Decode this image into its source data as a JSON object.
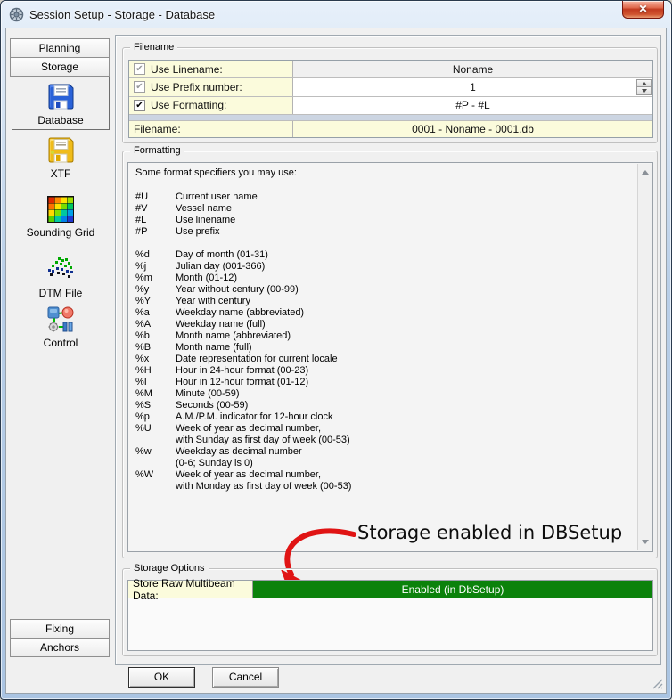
{
  "window": {
    "title": "Session Setup - Storage -  Database"
  },
  "icons": {
    "close": "✕",
    "check": "✔",
    "app_icon": "gear-icon",
    "spinner": "up-down-arrows",
    "scrollbar": "up-down-arrows"
  },
  "sidebar": {
    "top_buttons": [
      {
        "label": "Planning"
      },
      {
        "label": "Storage"
      }
    ],
    "nav_items": [
      {
        "label": "Database",
        "icon": "blue-floppy-disk",
        "selected": true
      },
      {
        "label": "XTF",
        "icon": "yellow-floppy-disk",
        "selected": false
      },
      {
        "label": "Sounding Grid",
        "icon": "rainbow-grid",
        "selected": false
      },
      {
        "label": "DTM File",
        "icon": "pixel-mesh",
        "selected": false
      },
      {
        "label": "Control",
        "icon": "control-composite",
        "selected": false
      }
    ],
    "bottom_buttons": [
      {
        "label": "Fixing"
      },
      {
        "label": "Anchors"
      }
    ]
  },
  "filename_group": {
    "legend": "Filename",
    "rows": [
      {
        "label": "Use Linename:",
        "value": "Noname",
        "checked": true,
        "enabled": false
      },
      {
        "label": "Use Prefix number:",
        "value": "1",
        "checked": true,
        "enabled": false
      },
      {
        "label": "Use Formatting:",
        "value": "#P - #L",
        "checked": true,
        "enabled": true
      }
    ],
    "filename_row": {
      "label": "Filename:",
      "value": "0001 - Noname - 0001.db"
    }
  },
  "formatting_group": {
    "legend": "Formatting",
    "intro": "Some format specifiers you may use:",
    "items": [
      {
        "spec": "#U",
        "desc": "Current user name"
      },
      {
        "spec": "#V",
        "desc": "Vessel name"
      },
      {
        "spec": "#L",
        "desc": "Use linename"
      },
      {
        "spec": "#P",
        "desc": "Use prefix"
      },
      {
        "spec": "%d",
        "desc": "Day of month (01-31)"
      },
      {
        "spec": "%j",
        "desc": "Julian day (001-366)"
      },
      {
        "spec": "%m",
        "desc": "Month (01-12)"
      },
      {
        "spec": "%y",
        "desc": "Year without century (00-99)"
      },
      {
        "spec": "%Y",
        "desc": "Year with century"
      },
      {
        "spec": "%a",
        "desc": "Weekday name (abbreviated)"
      },
      {
        "spec": "%A",
        "desc": "Weekday name (full)"
      },
      {
        "spec": "%b",
        "desc": "Month name (abbreviated)"
      },
      {
        "spec": "%B",
        "desc": "Month name (full)"
      },
      {
        "spec": "%x",
        "desc": "Date representation for current locale"
      },
      {
        "spec": "%H",
        "desc": "Hour in 24-hour format (00-23)"
      },
      {
        "spec": "%I",
        "desc": "Hour in 12-hour format (01-12)"
      },
      {
        "spec": "%M",
        "desc": "Minute (00-59)"
      },
      {
        "spec": "%S",
        "desc": "Seconds (00-59)"
      },
      {
        "spec": "%p",
        "desc": "A.M./P.M. indicator for 12-hour clock"
      },
      {
        "spec": "%U",
        "desc": "Week of year as decimal number,\nwith Sunday as first day of week (00-53)"
      },
      {
        "spec": "%w",
        "desc": "Weekday as decimal number\n(0-6; Sunday is 0)"
      },
      {
        "spec": "%W",
        "desc": "Week of year as decimal number,\nwith Monday as first day of week (00-53)"
      }
    ]
  },
  "annotation": {
    "text": "Storage enabled in DBSetup",
    "arrow_color": "#e01414"
  },
  "storage_group": {
    "legend": "Storage Options",
    "row": {
      "label": "Store Raw Multibeam Data:",
      "value": "Enabled (in DbSetup)",
      "status_color": "#0b820b"
    }
  },
  "footer": {
    "ok": "OK",
    "cancel": "Cancel"
  },
  "colors": {
    "row_highlight_yellow": "#fbfbdc",
    "status_green": "#0b820b",
    "annotation_arrow_red": "#e01414",
    "titlebar_glass_blue": "#b9cfe8",
    "dialog_gray": "#f0f0f0"
  }
}
